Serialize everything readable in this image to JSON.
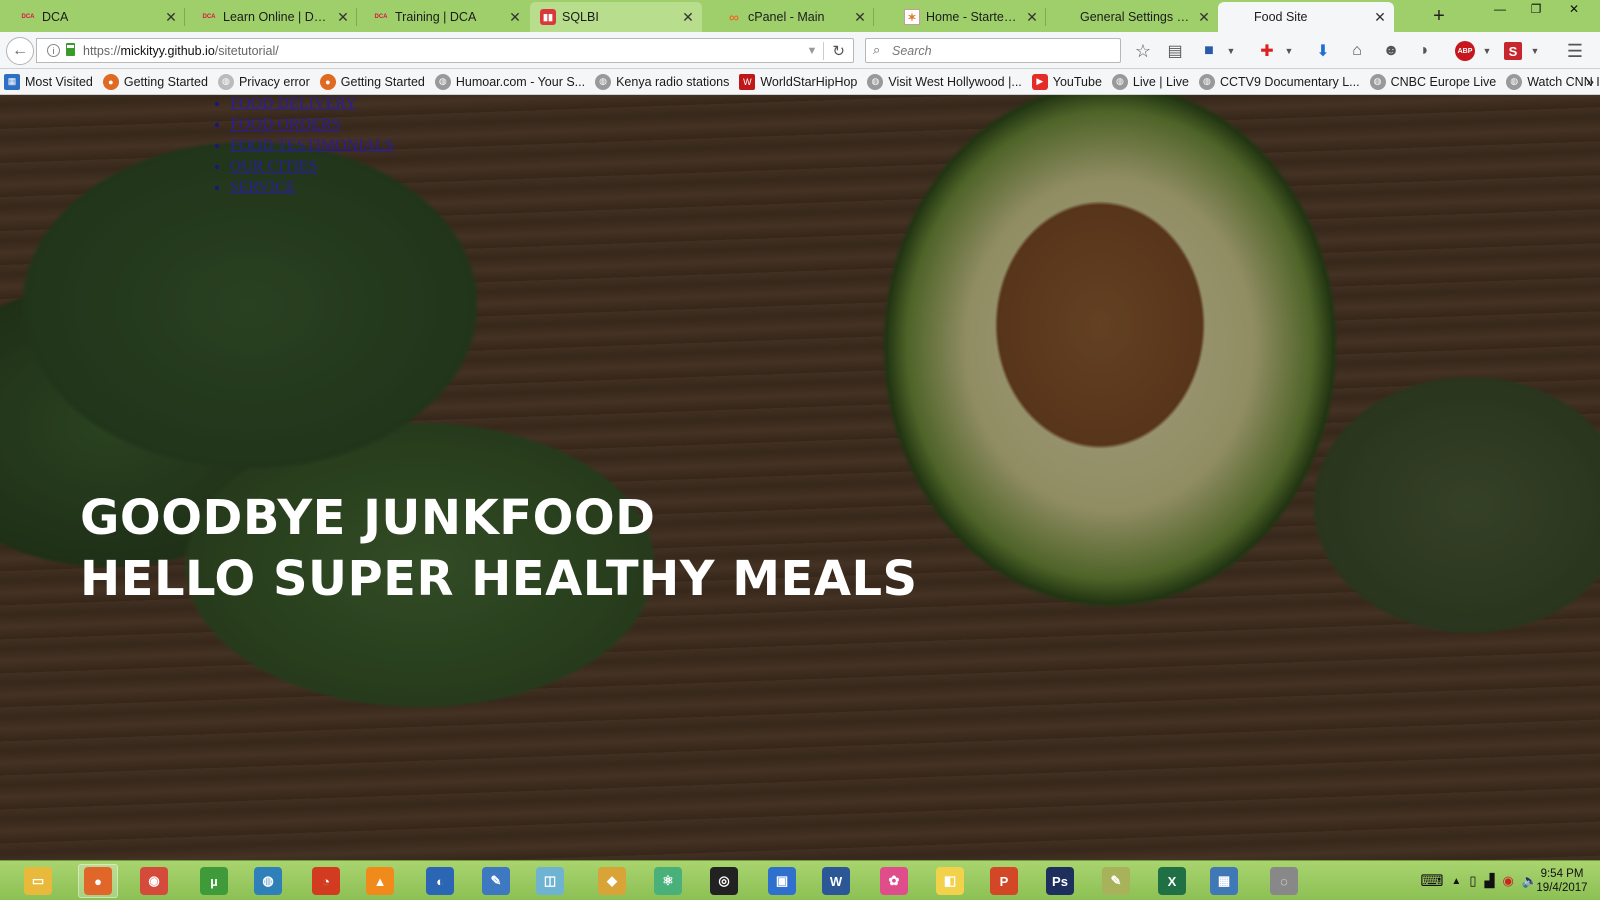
{
  "tabs": [
    {
      "title": "DCA",
      "favicon": "DCA"
    },
    {
      "title": "Learn Online | DCA",
      "favicon": "DCA"
    },
    {
      "title": "Training | DCA",
      "favicon": "DCA"
    },
    {
      "title": "SQLBI",
      "favicon": "sqlbi-icon"
    },
    {
      "title": "cPanel - Main",
      "favicon": "cpanel-icon"
    },
    {
      "title": "Home - Startech Bu...",
      "favicon": "startech-icon"
    },
    {
      "title": "General Settings ‹ Starte...",
      "favicon": ""
    },
    {
      "title": "Food Site",
      "favicon": ""
    }
  ],
  "navbar": {
    "url_prefix": "https://",
    "url_host": "mickityy.github.io",
    "url_path": "/sitetutorial/",
    "search_placeholder": "Search"
  },
  "bookmarks": [
    {
      "label": "Most Visited",
      "icon": "bookmarks-folder-icon"
    },
    {
      "label": "Getting Started",
      "icon": "firefox-icon"
    },
    {
      "label": "Privacy error",
      "icon": "globe-icon"
    },
    {
      "label": "Getting Started",
      "icon": "firefox-icon"
    },
    {
      "label": "Humoar.com - Your S...",
      "icon": "globe-icon"
    },
    {
      "label": "Kenya radio stations",
      "icon": "globe-icon"
    },
    {
      "label": "WorldStarHipHop",
      "icon": "worldstar-icon"
    },
    {
      "label": "Visit West Hollywood |...",
      "icon": "globe-icon"
    },
    {
      "label": "YouTube",
      "icon": "youtube-icon"
    },
    {
      "label": "Live | Live",
      "icon": "globe-icon"
    },
    {
      "label": "CCTV9 Documentary L...",
      "icon": "globe-icon"
    },
    {
      "label": "CNBC Europe Live",
      "icon": "globe-icon"
    },
    {
      "label": "Watch CNN Internatio...",
      "icon": "globe-icon"
    }
  ],
  "site": {
    "nav_items": [
      "FOOD DELIVERY",
      "FOOD ORDERS",
      "FOOD TESTIMONIALS",
      "OUR CITIES",
      "SERVICE"
    ],
    "hero_line1": "GOODBYE JUNKFOOD",
    "hero_line2": "HELLO SUPER HEALTHY MEALS"
  },
  "taskbar": {
    "apps": [
      {
        "name": "file-explorer",
        "color": "#e9b93c"
      },
      {
        "name": "firefox",
        "color": "#e0662a"
      },
      {
        "name": "chrome",
        "color": "#d44b3b"
      },
      {
        "name": "utorrent",
        "color": "#3f9a3a"
      },
      {
        "name": "network-app",
        "color": "#2f7fb8"
      },
      {
        "name": "opera-like",
        "color": "#d23b1f"
      },
      {
        "name": "vlc",
        "color": "#f08a1a"
      },
      {
        "name": "skype-like",
        "color": "#2b66b5"
      },
      {
        "name": "notepad",
        "color": "#3d78c0"
      },
      {
        "name": "ruler-app",
        "color": "#6fb3d3"
      },
      {
        "name": "tiles-app",
        "color": "#d8a437"
      },
      {
        "name": "atom",
        "color": "#4ab07a"
      },
      {
        "name": "webcam",
        "color": "#222222"
      },
      {
        "name": "orange-app",
        "color": "#2f6fcd"
      },
      {
        "name": "word",
        "color": "#2b5797"
      },
      {
        "name": "picasa",
        "color": "#e04d8b"
      },
      {
        "name": "sticky-notes",
        "color": "#f2d24a"
      },
      {
        "name": "powerpoint",
        "color": "#d24726"
      },
      {
        "name": "photoshop",
        "color": "#1e2f5e"
      },
      {
        "name": "notepad-plus",
        "color": "#a8b25a"
      },
      {
        "name": "excel",
        "color": "#1f7145"
      },
      {
        "name": "photos",
        "color": "#3f78b5"
      },
      {
        "name": "media-player",
        "color": "#888888"
      }
    ],
    "clock_time": "9:54 PM",
    "clock_date": "19/4/2017"
  }
}
